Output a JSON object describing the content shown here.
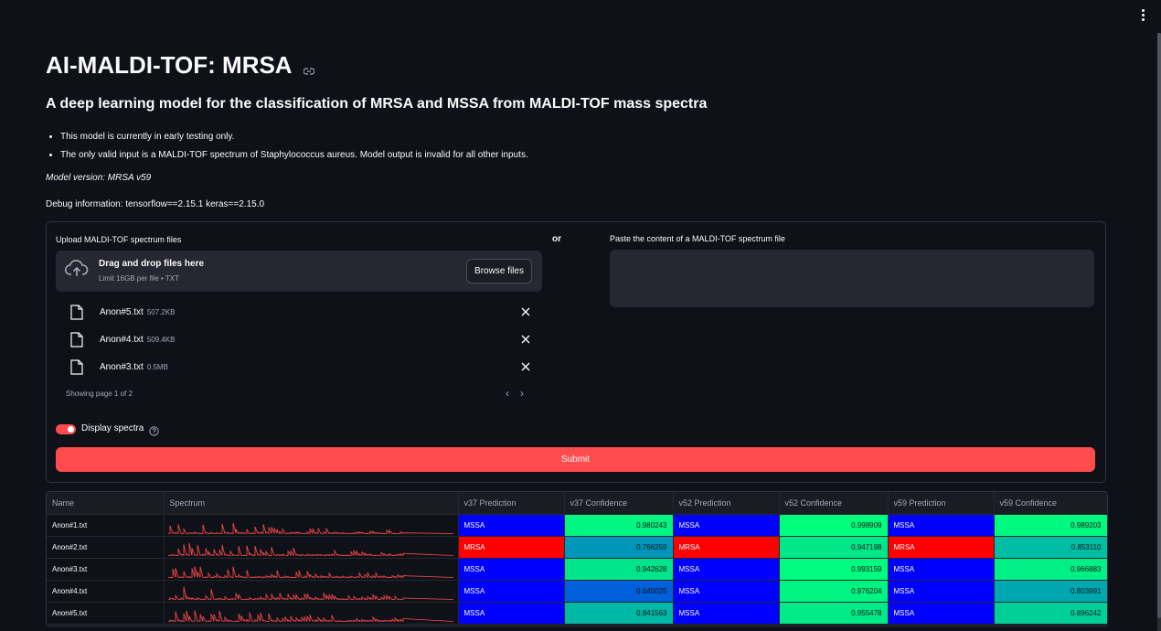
{
  "colors": {
    "background": "#0e1117",
    "accent": "#ff4b4b",
    "mssa": "#0000ff",
    "mrsa": "#ff0000",
    "spectrum_line": "#ff4b4b"
  },
  "header": {
    "menu_icon": "vertical-ellipsis-icon"
  },
  "page": {
    "title": "AI-MALDI-TOF: MRSA",
    "subtitle": "A deep learning model for the classification of MRSA and MSSA from MALDI-TOF mass spectra",
    "bullets": [
      "This model is currently in early testing only.",
      "The only valid input is a MALDI-TOF spectrum of Staphylococcus aureus. Model output is invalid for all other inputs."
    ],
    "model_version": "Model version: MRSA v59",
    "debug": "Debug information: tensorflow==2.15.1 keras==2.15.0"
  },
  "upload": {
    "label": "Upload MALDI-TOF spectrum files",
    "drop_title": "Drag and drop files here",
    "drop_sub": "Limit 16GB per file • TXT",
    "browse_label": "Browse files",
    "files": [
      {
        "name": "Anon#5.txt",
        "size": "507.2KB"
      },
      {
        "name": "Anon#4.txt",
        "size": "509.4KB"
      },
      {
        "name": "Anon#3.txt",
        "size": "0.5MB"
      }
    ],
    "pager": "Showing page 1 of 2"
  },
  "or_label": "or",
  "paste": {
    "label": "Paste the content of a MALDI-TOF spectrum file",
    "value": ""
  },
  "toggle": {
    "label": "Display spectra",
    "checked": true
  },
  "submit_label": "Submit",
  "results": {
    "columns": [
      "Name",
      "Spectrum",
      "v37 Prediction",
      "v37 Confidence",
      "v52 Prediction",
      "v52 Confidence",
      "v59 Prediction",
      "v59 Confidence"
    ],
    "rows": [
      {
        "name": "Anon#1.txt",
        "v37": "MSSA",
        "v37c": "0.980243",
        "v52": "MSSA",
        "v52c": "0.998909",
        "v59": "MSSA",
        "v59c": "0.989203"
      },
      {
        "name": "Anon#2.txt",
        "v37": "MRSA",
        "v37c": "0.766259",
        "v52": "MRSA",
        "v52c": "0.947198",
        "v59": "MRSA",
        "v59c": "0.853110"
      },
      {
        "name": "Anon#3.txt",
        "v37": "MSSA",
        "v37c": "0.942628",
        "v52": "MSSA",
        "v52c": "0.993159",
        "v59": "MSSA",
        "v59c": "0.966883"
      },
      {
        "name": "Anon#4.txt",
        "v37": "MSSA",
        "v37c": "0.645025",
        "v52": "MSSA",
        "v52c": "0.976204",
        "v59": "MSSA",
        "v59c": "0.803991"
      },
      {
        "name": "Anon#5.txt",
        "v37": "MSSA",
        "v37c": "0.841563",
        "v52": "MSSA",
        "v52c": "0.955478",
        "v59": "MSSA",
        "v59c": "0.896242"
      }
    ]
  }
}
